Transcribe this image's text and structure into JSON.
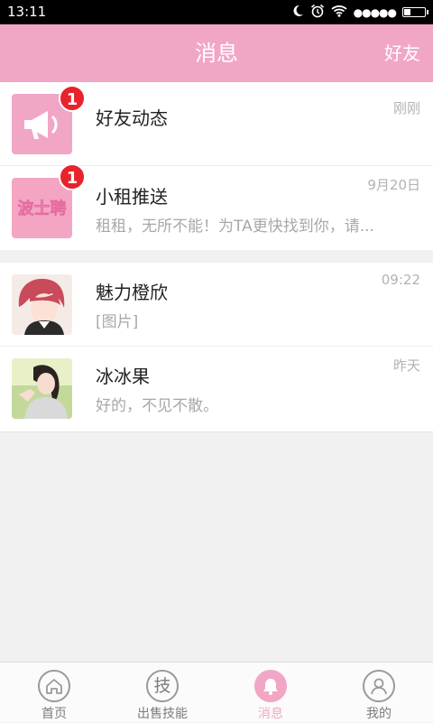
{
  "status_bar": {
    "time": "13:11",
    "icons": [
      "moon-icon",
      "alarm-icon",
      "wifi-icon",
      "signal-icon",
      "battery-icon"
    ],
    "signal_dots": "●●●●●"
  },
  "header": {
    "title": "消息",
    "right_action": "好友",
    "background_color": "#f2a6c6"
  },
  "messages": [
    {
      "name": "好友动态",
      "preview": "",
      "time": "刚刚",
      "badge": "1",
      "avatar": "megaphone-icon"
    },
    {
      "name": "小租推送",
      "preview": "租租，无所不能！为TA更快找到你，请...",
      "time": "9月20日",
      "badge": "1",
      "avatar": "logo",
      "avatar_logo_text": "波士聘"
    },
    {
      "name": "魅力橙欣",
      "preview": "[图片]",
      "time": "09:22",
      "badge": "",
      "avatar": "photo"
    },
    {
      "name": "冰冰果",
      "preview": "好的，不见不散。",
      "time": "昨天",
      "badge": "",
      "avatar": "photo"
    }
  ],
  "bottom_nav": {
    "items": [
      {
        "label": "首页",
        "icon": "home-icon",
        "active": false
      },
      {
        "label": "出售技能",
        "icon": "skill-icon",
        "icon_text": "技",
        "active": false
      },
      {
        "label": "消息",
        "icon": "bell-icon",
        "active": true
      },
      {
        "label": "我的",
        "icon": "user-icon",
        "active": false
      }
    ],
    "active_color": "#f2a6c6"
  }
}
